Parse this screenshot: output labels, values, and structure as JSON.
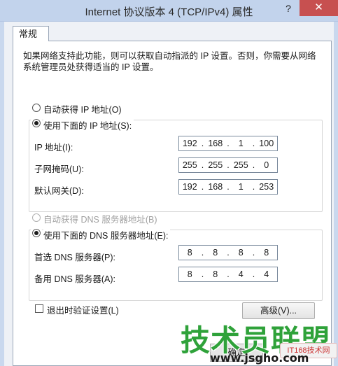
{
  "window": {
    "title": "Internet 协议版本 4 (TCP/IPv4) 属性",
    "help_label": "?",
    "close_label": "✕"
  },
  "tabs": [
    {
      "label": "常规",
      "selected": true
    }
  ],
  "intro_text": "如果网络支持此功能，则可以获取自动指派的 IP 设置。否则，你需要从网络系统管理员处获得适当的 IP 设置。",
  "ip_mode": {
    "auto_label": "自动获得 IP 地址(O)",
    "manual_label": "使用下面的 IP 地址(S):",
    "selected": "manual"
  },
  "ip_fields": [
    {
      "label": "IP 地址(I):",
      "octets": [
        "192",
        "168",
        "1",
        "100"
      ]
    },
    {
      "label": "子网掩码(U):",
      "octets": [
        "255",
        "255",
        "255",
        "0"
      ]
    },
    {
      "label": "默认网关(D):",
      "octets": [
        "192",
        "168",
        "1",
        "253"
      ]
    }
  ],
  "dns_mode": {
    "auto_label": "自动获得 DNS 服务器地址(B)",
    "manual_label": "使用下面的 DNS 服务器地址(E):",
    "selected": "manual",
    "auto_disabled": true
  },
  "dns_fields": [
    {
      "label": "首选 DNS 服务器(P):",
      "octets": [
        "8",
        "8",
        "8",
        "8"
      ]
    },
    {
      "label": "备用 DNS 服务器(A):",
      "octets": [
        "8",
        "8",
        "4",
        "4"
      ]
    }
  ],
  "validate_label": "退出时验证设置(L)",
  "validate_checked": false,
  "advanced_label": "高级(V)...",
  "ok_label": "确定",
  "watermark": {
    "title": "技术员联盟",
    "url": "www.jsgho.com",
    "badge": "IT168技术网"
  },
  "colors": {
    "close_button": "#c75050",
    "watermark_green": "#2fa23a"
  }
}
